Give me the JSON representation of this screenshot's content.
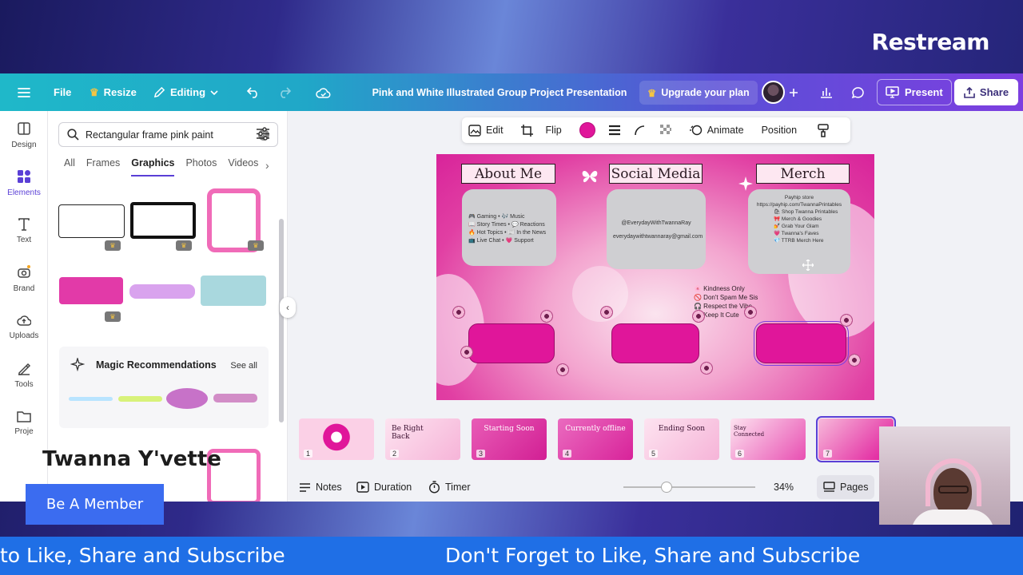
{
  "stream": {
    "brand": "Restream",
    "streamer_name": "Twanna Y'vette",
    "member_button": "Be A Member",
    "ticker_text_left": "to Like, Share and Subscribe",
    "ticker_text_right": "Don't Forget to Like, Share and Subscribe"
  },
  "topbar": {
    "file": "File",
    "resize": "Resize",
    "editing": "Editing",
    "title": "Pink and White Illustrated Group Project Presentation",
    "upgrade": "Upgrade your plan",
    "present": "Present",
    "share": "Share",
    "colors": {
      "gradient_start": "#1fb8c9",
      "gradient_end": "#7d3fe0"
    }
  },
  "rail": {
    "items": [
      {
        "label": "Design",
        "icon": "design-icon"
      },
      {
        "label": "Elements",
        "icon": "elements-icon",
        "active": true
      },
      {
        "label": "Text",
        "icon": "text-icon"
      },
      {
        "label": "Brand",
        "icon": "brand-icon"
      },
      {
        "label": "Uploads",
        "icon": "uploads-icon"
      },
      {
        "label": "Tools",
        "icon": "tools-icon"
      },
      {
        "label": "Proje",
        "icon": "projects-icon"
      }
    ]
  },
  "panel": {
    "search_value": "Rectangular frame pink paint",
    "tabs": [
      "All",
      "Frames",
      "Graphics",
      "Photos",
      "Videos"
    ],
    "active_tab": "Graphics",
    "magic_title": "Magic Recommendations",
    "see_all": "See all"
  },
  "context_toolbar": {
    "edit": "Edit",
    "flip": "Flip",
    "animate": "Animate",
    "position": "Position",
    "fill_color": "#e0169a"
  },
  "slide": {
    "titles": [
      "About Me",
      "Social Media",
      "Merch"
    ],
    "about_lines": [
      "🎮 Gaming • 🎶 Music",
      "📖 Story Times • 💬 Reactions",
      "🔥 Hot Topics • 📰 In the News",
      "📺 Live Chat • 💗 Support"
    ],
    "social_lines": [
      "@EverydayWithTwannaRay",
      "everydaywithtwannaray@gmail.com"
    ],
    "merch_lines": [
      "Payhip store",
      "https://payhip.com/TwannaPrintables",
      "🛍 Shop Twanna Printables",
      "🎀 Merch & Goodies",
      "💅 Grab Your Glam",
      "💗 Twanna's Faves",
      "💎 TTRB Merch Here"
    ],
    "rules_lines": [
      "🌸 Kindness Only",
      "🚫 Don't Spam Me Sis",
      "🎧 Respect the Vibe",
      "💬 Keep It Cute"
    ]
  },
  "thumbnails": [
    {
      "num": "1",
      "title": ""
    },
    {
      "num": "2",
      "title": "Be Right Back"
    },
    {
      "num": "3",
      "title": "Starting Soon"
    },
    {
      "num": "4",
      "title": "Currently offline"
    },
    {
      "num": "5",
      "title": "Ending Soon"
    },
    {
      "num": "6",
      "title": "Stay Connected"
    },
    {
      "num": "7",
      "title": "",
      "active": true
    }
  ],
  "bottombar": {
    "notes": "Notes",
    "duration": "Duration",
    "timer": "Timer",
    "zoom": "34%",
    "zoom_fraction": 0.3,
    "pages": "Pages"
  }
}
